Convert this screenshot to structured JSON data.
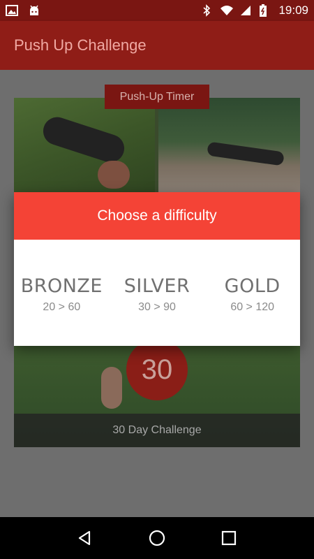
{
  "status_bar": {
    "time": "19:09",
    "icons": [
      "image-icon",
      "android-icon",
      "bluetooth-icon",
      "wifi-icon",
      "signal-icon",
      "battery-icon"
    ]
  },
  "app_bar": {
    "title": "Push Up Challenge"
  },
  "cards": {
    "timer_label": "Push-Up Timer",
    "challenge_number": "30",
    "challenge_label": "30 Day Challenge"
  },
  "dialog": {
    "title": "Choose a difficulty",
    "options": [
      {
        "name": "BRONZE",
        "range": "20 > 60"
      },
      {
        "name": "SILVER",
        "range": "30 > 90"
      },
      {
        "name": "GOLD",
        "range": "60 > 120"
      }
    ]
  },
  "nav_bar": {
    "buttons": [
      "back-icon",
      "home-icon",
      "recents-icon"
    ]
  },
  "colors": {
    "primary": "#8f1d17",
    "primary_dark": "#7a1612",
    "accent": "#f44336"
  }
}
